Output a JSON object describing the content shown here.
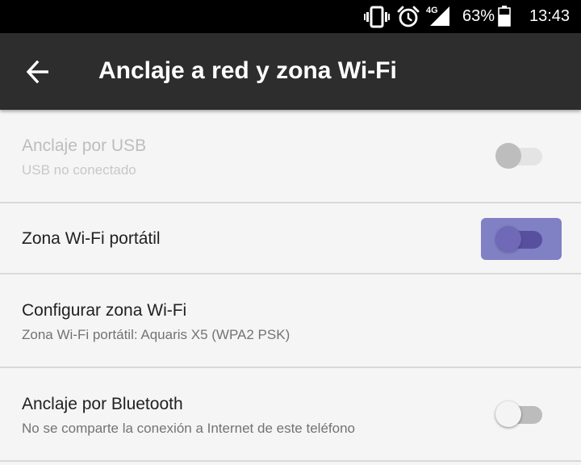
{
  "status_bar": {
    "icons": [
      "vibrate-icon",
      "alarm-icon",
      "signal-4g-icon",
      "battery-icon"
    ],
    "network_type": "4G",
    "battery_percent": "63%",
    "battery_level": 0.63,
    "time": "13:43"
  },
  "toolbar": {
    "back_icon": "arrow-left-icon",
    "title": "Anclaje a red y zona Wi-Fi"
  },
  "settings": {
    "usb": {
      "title": "Anclaje por USB",
      "subtitle": "USB no conectado",
      "enabled": false,
      "checked": false
    },
    "hotspot": {
      "title": "Zona Wi-Fi portátil",
      "enabled": true,
      "checked": false,
      "focused": true
    },
    "configure": {
      "title": "Configurar zona Wi-Fi",
      "subtitle": "Zona Wi-Fi portátil: Aquaris X5 (WPA2 PSK)"
    },
    "bluetooth": {
      "title": "Anclaje por Bluetooth",
      "subtitle": "No se comparte la conexión a Internet de este teléfono",
      "enabled": true,
      "checked": false
    }
  },
  "colors": {
    "toolbar_bg": "#2d2d2d",
    "status_bar_bg": "#000000",
    "focus_highlight": "#8080c4",
    "focused_track": "#58509e",
    "list_bg": "#f5f5f5",
    "divider": "#d9d9d9"
  }
}
